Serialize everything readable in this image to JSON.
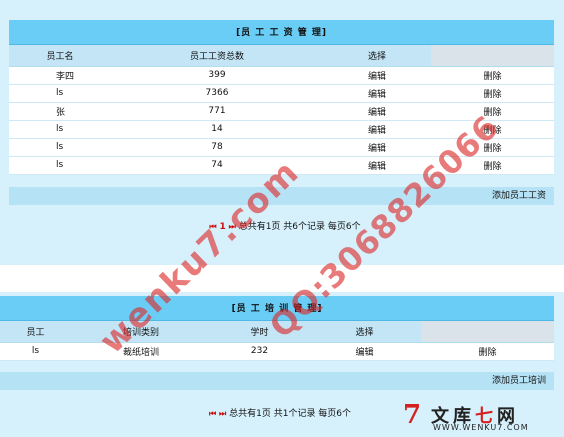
{
  "salary": {
    "title": "[员 工 工 资 管 理]",
    "headers": [
      "员工名",
      "员工工资总数",
      "选择",
      ""
    ],
    "rows": [
      {
        "name": "李四",
        "amount": "399",
        "edit": "编辑",
        "del": "删除"
      },
      {
        "name": "ls",
        "amount": "7366",
        "edit": "编辑",
        "del": "删除"
      },
      {
        "name": "张",
        "amount": "771",
        "edit": "编辑",
        "del": "删除"
      },
      {
        "name": "ls",
        "amount": "14",
        "edit": "编辑",
        "del": "删除"
      },
      {
        "name": "ls",
        "amount": "78",
        "edit": "编辑",
        "del": "删除"
      },
      {
        "name": "ls",
        "amount": "74",
        "edit": "编辑",
        "del": "删除"
      }
    ],
    "add_label": "添加员工工资",
    "pager": {
      "first": "⏮",
      "current": "1",
      "last": "⏭",
      "info": "总共有1页 共6个记录 每页6个"
    }
  },
  "training": {
    "title": "[员 工 培 训 管 理]",
    "headers": [
      "员工",
      "培训类别",
      "学时",
      "选择",
      ""
    ],
    "rows": [
      {
        "name": "ls",
        "category": "裁纸培训",
        "hours": "232",
        "edit": "编辑",
        "del": "删除"
      }
    ],
    "add_label": "添加员工培训",
    "pager": {
      "first": "⏮",
      "last": "⏭",
      "info": "总共有1页 共1个记录 每页6个"
    }
  },
  "watermark": {
    "site": "wenku7.com",
    "qq": "QQ:3068826066",
    "logo_text_a": "文库",
    "logo_text_b": "七",
    "logo_text_c": "网",
    "logo_url": "WWW.WENKU7.COM"
  },
  "colors": {
    "title_bar": "#69cdf5",
    "header_row": "#c3e5f6",
    "panel_bg": "#d7f1fc",
    "accent_red": "#cc1010"
  }
}
